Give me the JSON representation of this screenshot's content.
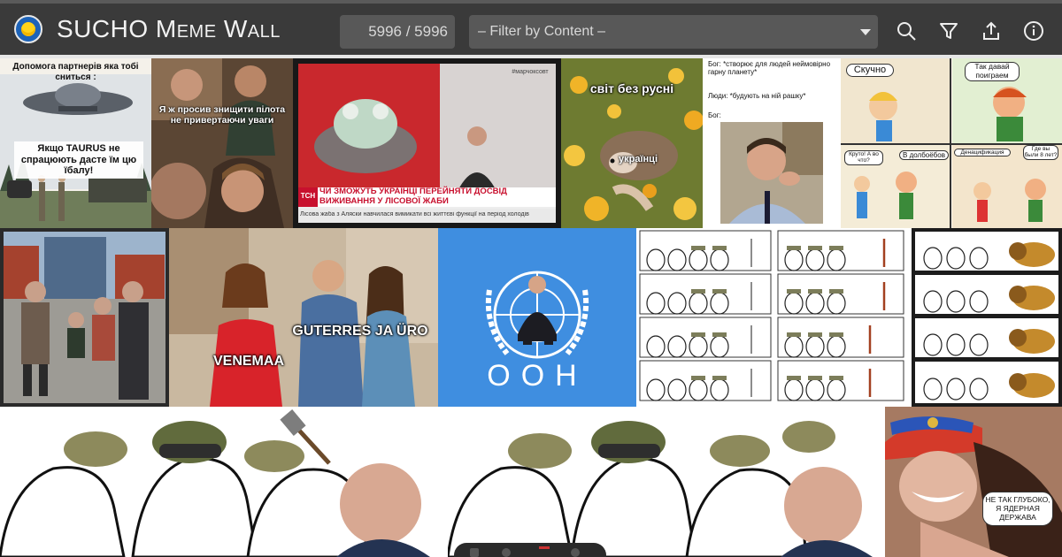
{
  "header": {
    "title": "SUCHO Meme Wall",
    "counter": "5996 / 5996",
    "filter_placeholder": "– Filter by Content –",
    "icons": [
      "search-icon",
      "filter-icon",
      "upload-icon",
      "info-icon"
    ]
  },
  "memes": {
    "ufo": {
      "top": "Допомога партнерів яка тобі сниться :",
      "bottom": "Якщо TAURUS не спрацюють дасте їм цю їбалу!"
    },
    "pilot": {
      "text": "Я ж просив знищити пілота не привертаючи уваги"
    },
    "news": {
      "channel": "TCH",
      "corner": "#марчоксовт",
      "headline": "ЧИ ЗМОЖУТЬ УКРАЇНЦІ ПЕРЕЙНЯТИ ДОСВІД ВИЖИВАННЯ У ЛІСОВОЇ ЖАБИ",
      "ticker": "Лісова жаба з Аляски навчилася вимикати всі життєві функції на період холодів"
    },
    "hedgehog": {
      "top": "світ без русні",
      "label": "українці"
    },
    "god": {
      "line1": "Бог: *створює для людей неймовірно гарну планету*",
      "line2": "Люди: *будують на ній рашку*",
      "line3": "Бог:"
    },
    "cartoon": {
      "b1": "Скучно",
      "b2": "Так давай поиграем",
      "b3": "Круто! А во что?",
      "b4": "В долбоёбов",
      "b5": "Денацификация",
      "b6": "Где вы были 8 лет?"
    },
    "distracted": {
      "left": "VENEMAA",
      "right": "GUTERRES JA ÜRO"
    },
    "un": {
      "text": "ООН"
    },
    "woman": {
      "bubble": "НЕ ТАК ГЛУБОКО, Я ЯДЕРНАЯ ДЕРЖАВА"
    }
  }
}
